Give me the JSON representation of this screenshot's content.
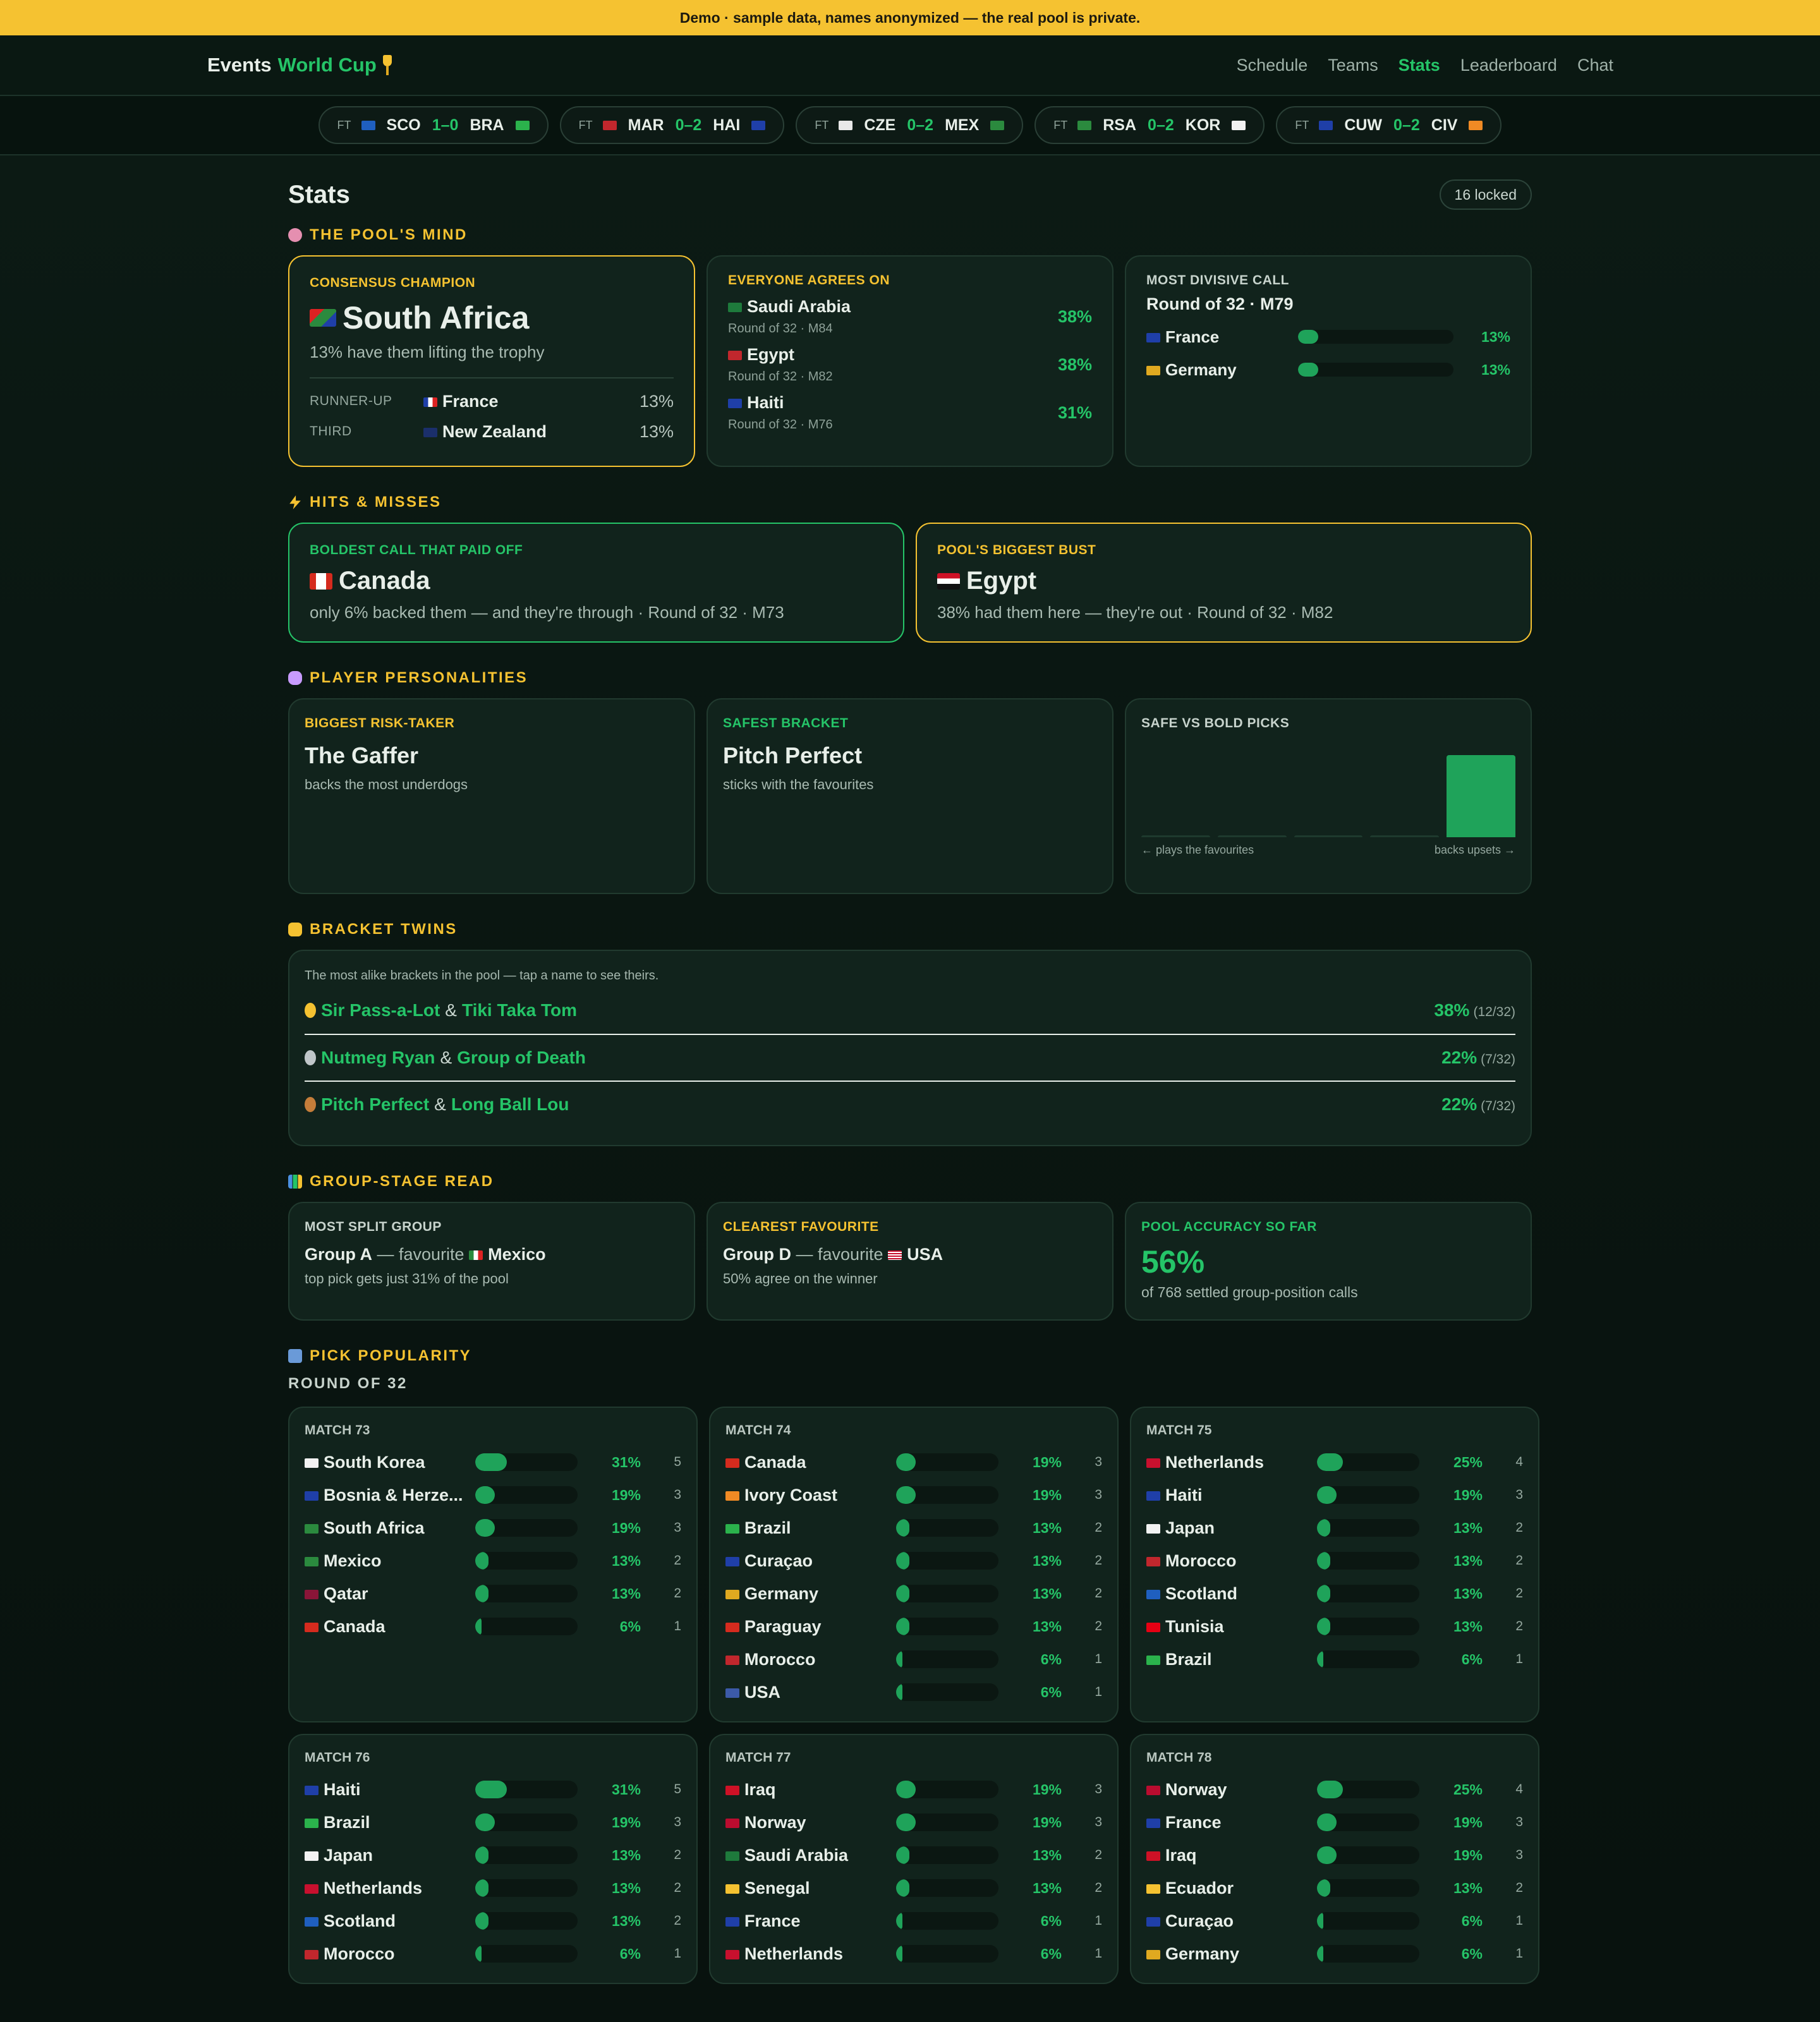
{
  "banner": "Demo · sample data, names anonymized — the real pool is private.",
  "logo": {
    "part1": "Events",
    "part2": "World Cup"
  },
  "nav": [
    "Schedule",
    "Teams",
    "Stats",
    "Leaderboard",
    "Chat"
  ],
  "ticker": [
    {
      "status": "FT",
      "home": "SCO",
      "score": "1–0",
      "away": "BRA",
      "hc": "#1f5fbf",
      "ac": "#2bb24c"
    },
    {
      "status": "FT",
      "home": "MAR",
      "score": "0–2",
      "away": "HAI",
      "hc": "#c1272d",
      "ac": "#1f3fa8"
    },
    {
      "status": "FT",
      "home": "CZE",
      "score": "0–2",
      "away": "MEX",
      "hc": "#e8e8e8",
      "ac": "#2b8a3e"
    },
    {
      "status": "FT",
      "home": "RSA",
      "score": "0–2",
      "away": "KOR",
      "hc": "#2b8a3e",
      "ac": "#f2f2f2"
    },
    {
      "status": "FT",
      "home": "CUW",
      "score": "0–2",
      "away": "CIV",
      "hc": "#1f3fa8",
      "ac": "#f08a24"
    }
  ],
  "page": {
    "title": "Stats",
    "locked": "16 locked"
  },
  "sections": {
    "mind": "THE POOL'S MIND",
    "hits": "HITS & MISSES",
    "personalities": "PLAYER PERSONALITIES",
    "twins": "BRACKET TWINS",
    "group": "GROUP-STAGE READ",
    "popularity": "PICK POPULARITY",
    "round": "ROUND OF 32"
  },
  "champion": {
    "label": "CONSENSUS CHAMPION",
    "name": "South Africa",
    "sub": "13% have them lifting the trophy",
    "runner_label": "RUNNER-UP",
    "runner": "France",
    "runner_pct": "13%",
    "third_label": "THIRD",
    "third": "New Zealand",
    "third_pct": "13%"
  },
  "agrees": {
    "label": "EVERYONE AGREES ON",
    "items": [
      {
        "name": "Saudi Arabia",
        "meta": "Round of 32 · M84",
        "pct": "38%",
        "color": "#1e7a3c"
      },
      {
        "name": "Egypt",
        "meta": "Round of 32 · M82",
        "pct": "38%",
        "color": "#c1272d"
      },
      {
        "name": "Haiti",
        "meta": "Round of 32 · M76",
        "pct": "31%",
        "color": "#1f3fa8"
      }
    ]
  },
  "divisive": {
    "label": "MOST DIVISIVE CALL",
    "match": "Round of 32 · M79",
    "items": [
      {
        "name": "France",
        "pct": "13%",
        "value": 13,
        "color": "#1f3fa8"
      },
      {
        "name": "Germany",
        "pct": "13%",
        "value": 13,
        "color": "#e0a920"
      }
    ]
  },
  "boldest": {
    "label": "BOLDEST CALL THAT PAID OFF",
    "name": "Canada",
    "sub": "only 6% backed them — and they're through · Round of 32 · M73"
  },
  "bust": {
    "label": "POOL'S BIGGEST BUST",
    "name": "Egypt",
    "sub": "38% had them here — they're out · Round of 32 · M82"
  },
  "risk": {
    "label": "BIGGEST RISK-TAKER",
    "name": "The Gaffer",
    "sub": "backs the most underdogs"
  },
  "safest": {
    "label": "SAFEST BRACKET",
    "name": "Pitch Perfect",
    "sub": "sticks with the favourites"
  },
  "safebold": {
    "label": "SAFE VS BOLD PICKS",
    "left": "← plays the favourites",
    "right": "backs upsets →",
    "bins": [
      0,
      0,
      0,
      0,
      1
    ]
  },
  "twins": {
    "note": "The most alike brackets in the pool — tap a name to see theirs.",
    "pairs": [
      {
        "a": "Sir Pass-a-Lot",
        "b": "Tiki Taka Tom",
        "pct": "38%",
        "frac": "(12/32)",
        "medal": "#f5c231"
      },
      {
        "a": "Nutmeg Ryan",
        "b": "Group of Death",
        "pct": "22%",
        "frac": "(7/32)",
        "medal": "#c0c6c9"
      },
      {
        "a": "Pitch Perfect",
        "b": "Long Ball Lou",
        "pct": "22%",
        "frac": "(7/32)",
        "medal": "#c57d3a"
      }
    ]
  },
  "groupread": {
    "split": {
      "label": "MOST SPLIT GROUP",
      "group": "Group A",
      "fav_word": "— favourite",
      "team": "Mexico",
      "sub": "top pick gets just 31% of the pool"
    },
    "clear": {
      "label": "CLEAREST FAVOURITE",
      "group": "Group D",
      "fav_word": "— favourite",
      "team": "USA",
      "sub": "50% agree on the winner"
    },
    "accuracy": {
      "label": "POOL ACCURACY SO FAR",
      "value": "56%",
      "sub": "of 768 settled group-position calls"
    }
  },
  "matches": [
    {
      "label": "MATCH 73",
      "rows": [
        {
          "n": "South Korea",
          "p": "31%",
          "v": 31,
          "c": "5",
          "f": "#f2f2f2"
        },
        {
          "n": "Bosnia & Herze...",
          "p": "19%",
          "v": 19,
          "c": "3",
          "f": "#1f3fa8"
        },
        {
          "n": "South Africa",
          "p": "19%",
          "v": 19,
          "c": "3",
          "f": "#2b8a3e"
        },
        {
          "n": "Mexico",
          "p": "13%",
          "v": 13,
          "c": "2",
          "f": "#2b8a3e"
        },
        {
          "n": "Qatar",
          "p": "13%",
          "v": 13,
          "c": "2",
          "f": "#8a1538"
        },
        {
          "n": "Canada",
          "p": "6%",
          "v": 6,
          "c": "1",
          "f": "#d52b1e"
        }
      ]
    },
    {
      "label": "MATCH 74",
      "rows": [
        {
          "n": "Canada",
          "p": "19%",
          "v": 19,
          "c": "3",
          "f": "#d52b1e"
        },
        {
          "n": "Ivory Coast",
          "p": "19%",
          "v": 19,
          "c": "3",
          "f": "#f08a24"
        },
        {
          "n": "Brazil",
          "p": "13%",
          "v": 13,
          "c": "2",
          "f": "#2bb24c"
        },
        {
          "n": "Curaçao",
          "p": "13%",
          "v": 13,
          "c": "2",
          "f": "#1f3fa8"
        },
        {
          "n": "Germany",
          "p": "13%",
          "v": 13,
          "c": "2",
          "f": "#e0a920"
        },
        {
          "n": "Paraguay",
          "p": "13%",
          "v": 13,
          "c": "2",
          "f": "#d52b1e"
        },
        {
          "n": "Morocco",
          "p": "6%",
          "v": 6,
          "c": "1",
          "f": "#c1272d"
        },
        {
          "n": "USA",
          "p": "6%",
          "v": 6,
          "c": "1",
          "f": "#3c5aa8"
        }
      ]
    },
    {
      "label": "MATCH 75",
      "rows": [
        {
          "n": "Netherlands",
          "p": "25%",
          "v": 25,
          "c": "4",
          "f": "#c8102e"
        },
        {
          "n": "Haiti",
          "p": "19%",
          "v": 19,
          "c": "3",
          "f": "#1f3fa8"
        },
        {
          "n": "Japan",
          "p": "13%",
          "v": 13,
          "c": "2",
          "f": "#f2f2f2"
        },
        {
          "n": "Morocco",
          "p": "13%",
          "v": 13,
          "c": "2",
          "f": "#c1272d"
        },
        {
          "n": "Scotland",
          "p": "13%",
          "v": 13,
          "c": "2",
          "f": "#1f5fbf"
        },
        {
          "n": "Tunisia",
          "p": "13%",
          "v": 13,
          "c": "2",
          "f": "#e70013"
        },
        {
          "n": "Brazil",
          "p": "6%",
          "v": 6,
          "c": "1",
          "f": "#2bb24c"
        }
      ]
    },
    {
      "label": "MATCH 76",
      "rows": [
        {
          "n": "Haiti",
          "p": "31%",
          "v": 31,
          "c": "5",
          "f": "#1f3fa8"
        },
        {
          "n": "Brazil",
          "p": "19%",
          "v": 19,
          "c": "3",
          "f": "#2bb24c"
        },
        {
          "n": "Japan",
          "p": "13%",
          "v": 13,
          "c": "2",
          "f": "#f2f2f2"
        },
        {
          "n": "Netherlands",
          "p": "13%",
          "v": 13,
          "c": "2",
          "f": "#c8102e"
        },
        {
          "n": "Scotland",
          "p": "13%",
          "v": 13,
          "c": "2",
          "f": "#1f5fbf"
        },
        {
          "n": "Morocco",
          "p": "6%",
          "v": 6,
          "c": "1",
          "f": "#c1272d"
        }
      ]
    },
    {
      "label": "MATCH 77",
      "rows": [
        {
          "n": "Iraq",
          "p": "19%",
          "v": 19,
          "c": "3",
          "f": "#ce1126"
        },
        {
          "n": "Norway",
          "p": "19%",
          "v": 19,
          "c": "3",
          "f": "#ba0c2f"
        },
        {
          "n": "Saudi Arabia",
          "p": "13%",
          "v": 13,
          "c": "2",
          "f": "#1e7a3c"
        },
        {
          "n": "Senegal",
          "p": "13%",
          "v": 13,
          "c": "2",
          "f": "#f5c231"
        },
        {
          "n": "France",
          "p": "6%",
          "v": 6,
          "c": "1",
          "f": "#1f3fa8"
        },
        {
          "n": "Netherlands",
          "p": "6%",
          "v": 6,
          "c": "1",
          "f": "#c8102e"
        }
      ]
    },
    {
      "label": "MATCH 78",
      "rows": [
        {
          "n": "Norway",
          "p": "25%",
          "v": 25,
          "c": "4",
          "f": "#ba0c2f"
        },
        {
          "n": "France",
          "p": "19%",
          "v": 19,
          "c": "3",
          "f": "#1f3fa8"
        },
        {
          "n": "Iraq",
          "p": "19%",
          "v": 19,
          "c": "3",
          "f": "#ce1126"
        },
        {
          "n": "Ecuador",
          "p": "13%",
          "v": 13,
          "c": "2",
          "f": "#f5c231"
        },
        {
          "n": "Curaçao",
          "p": "6%",
          "v": 6,
          "c": "1",
          "f": "#1f3fa8"
        },
        {
          "n": "Germany",
          "p": "6%",
          "v": 6,
          "c": "1",
          "f": "#e0a920"
        }
      ]
    }
  ]
}
